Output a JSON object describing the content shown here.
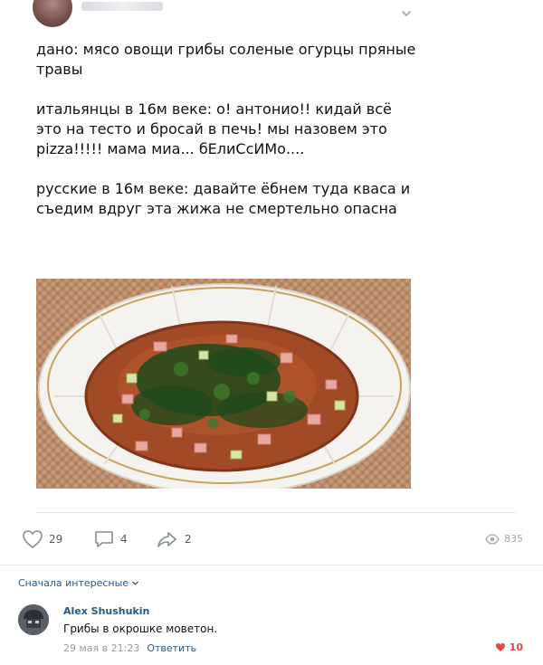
{
  "post": {
    "paragraphs": [
      "дано: мясо овощи грибы соленые огурцы пряные травы",
      "итальянцы в 16м веке: о! антонио!! кидай всё это на тесто и бросай в печь! мы назовем это pizza!!!!! мама миа... бЕлиСсИМо....",
      "русские в 16м веке: давайте ёбнем туда кваса и съедим вдруг эта жижа не смертельно опасна"
    ],
    "photo_icon": "okroshka-photo"
  },
  "actions": {
    "likes": "29",
    "comments": "4",
    "shares": "2",
    "views": "835"
  },
  "comments": {
    "sort_label": "Сначала интересные",
    "items": [
      {
        "author": "Alex Shushukin",
        "text": "Грибы в окрошке моветон.",
        "date": "29 мая в 21:23",
        "reply_label": "Ответить",
        "likes": "10"
      }
    ]
  },
  "colors": {
    "link": "#2a5885",
    "like_active": "#e64646",
    "muted": "#939ba3"
  }
}
